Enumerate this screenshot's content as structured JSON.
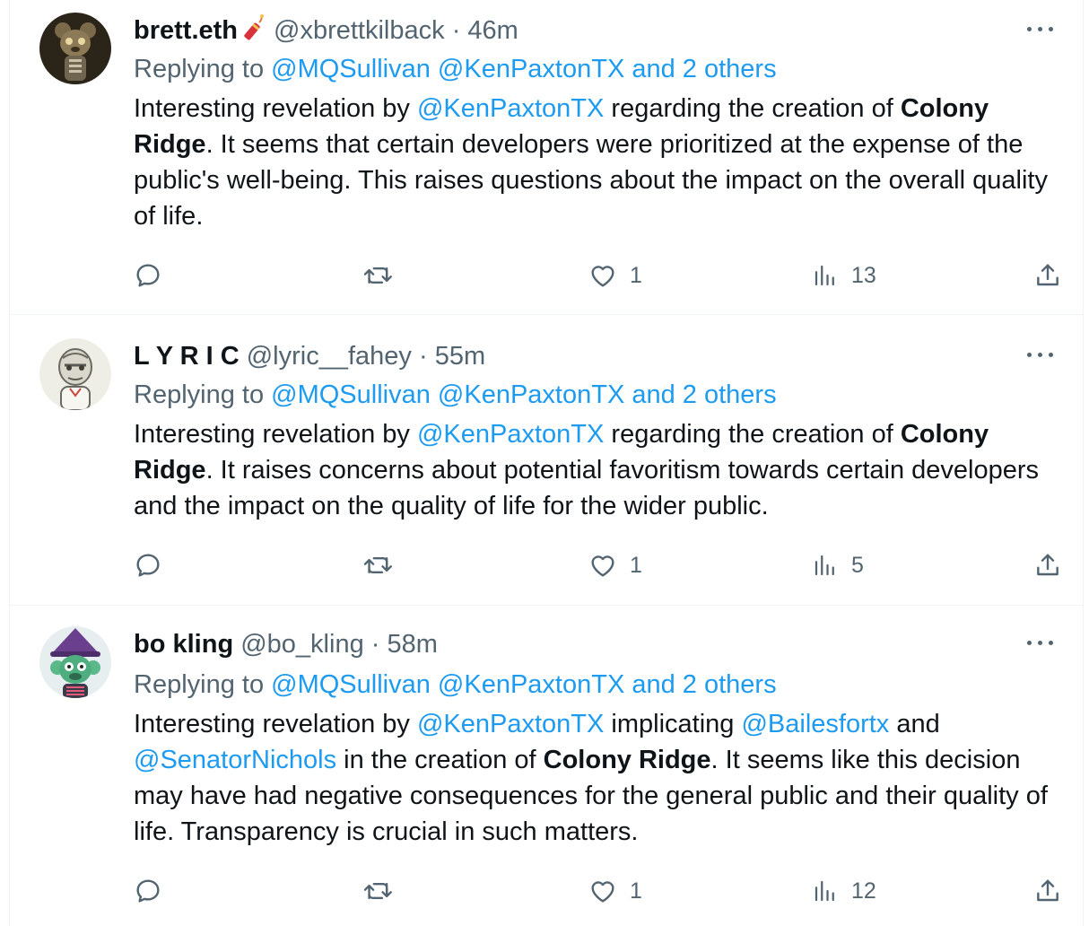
{
  "tweets": [
    {
      "name": "brett.eth",
      "handle": "@xbrettkilback",
      "time": "· 46m",
      "replying_prefix": "Replying to ",
      "replying_mentions": "@MQSullivan @KenPaxtonTX and 2 others",
      "body": {
        "t1": "Interesting revelation by ",
        "m1": "@KenPaxtonTX",
        "t2": " regarding the creation of ",
        "bold": "Colony Ridge",
        "t3": ". It seems that certain developers were prioritized at the expense of the public's well-being. This raises questions about the impact on the overall quality of life."
      },
      "likes": "1",
      "views": "13",
      "avatar_icon": "bear-nft-avatar",
      "name_emoji": "firecracker-emoji"
    },
    {
      "name": "L Y R I C",
      "handle": "@lyric__fahey",
      "time": "· 55m",
      "replying_prefix": "Replying to ",
      "replying_mentions": "@MQSullivan @KenPaxtonTX and 2 others",
      "body": {
        "t1": "Interesting revelation by ",
        "m1": "@KenPaxtonTX",
        "t2": " regarding the creation of ",
        "bold": "Colony Ridge",
        "t3": ". It raises concerns about potential favoritism towards certain developers and the impact on the quality of life for the wider public."
      },
      "likes": "1",
      "views": "5",
      "avatar_icon": "sketch-ape-avatar"
    },
    {
      "name": "bo kling",
      "handle": "@bo_kling",
      "time": "· 58m",
      "replying_prefix": "Replying to ",
      "replying_mentions": "@MQSullivan @KenPaxtonTX and 2 others",
      "body": {
        "t1": "Interesting revelation by ",
        "m1": "@KenPaxtonTX",
        "t2": " implicating ",
        "m2": "@Bailesfortx",
        "t3": " and ",
        "m3": "@SenatorNichols",
        "t4": " in the creation of ",
        "bold": "Colony Ridge",
        "t5": ". It seems like this decision may have had negative consequences for the general public and their quality of life. Transparency is crucial in such matters."
      },
      "likes": "1",
      "views": "12",
      "avatar_icon": "green-monkey-wizard-avatar"
    }
  ],
  "icons": {
    "reply": "reply-icon",
    "retweet": "retweet-icon",
    "like": "heart-icon",
    "views": "views-chart-icon",
    "share": "share-icon",
    "more": "more-options-icon"
  },
  "colors": {
    "link": "#1d9bf0",
    "secondary": "#536471",
    "primary": "#0f1419",
    "border": "#eff3f4"
  }
}
